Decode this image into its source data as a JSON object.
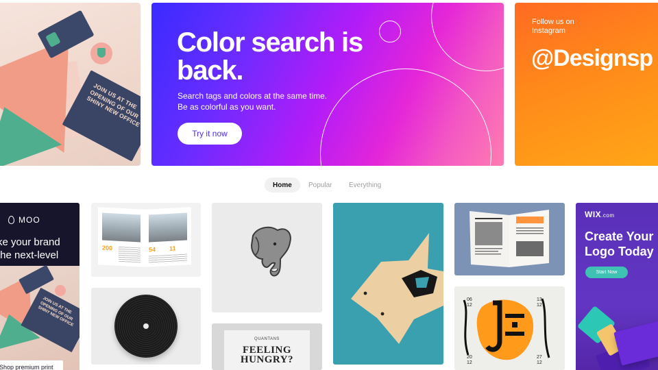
{
  "hero": {
    "left_card": {
      "card_text": "JOIN US AT THE OPENING OF OUR SHINY NEW OFFICE"
    },
    "main": {
      "title": "Color search is back.",
      "subtitle": "Search tags and colors at the same time. Be as colorful as you want.",
      "button_label": "Try it now"
    },
    "right": {
      "follow_text": "Follow us on Instagram",
      "handle": "@Designsp"
    }
  },
  "tabs": [
    {
      "label": "Home",
      "active": true
    },
    {
      "label": "Popular",
      "active": false
    },
    {
      "label": "Everything",
      "active": false
    }
  ],
  "tiles": {
    "moo": {
      "logo": "MOO",
      "copy_line1": "ke your brand",
      "copy_line2": "the next-level",
      "card_text": "JOIN US AT THE OPENING OF OUR SHINY NEW OFFICE",
      "cta": "Shop premium print"
    },
    "brochure": {
      "num_left": "200",
      "num_mid": "54",
      "num_right": "11"
    },
    "hungry": {
      "logo": "QUANTANS",
      "title_line1": "FEELING",
      "title_line2": "HUNGRY?"
    },
    "jazz": {
      "date_top_left": "06\n12",
      "date_top_right": "13\n12",
      "date_bottom_left": "20\n12",
      "date_bottom_right": "27\n12"
    },
    "wix": {
      "logo": "WIX",
      "logo_suffix": ".com",
      "title_line1": "Create Your",
      "title_line2": "Logo Today",
      "button_label": "Start Now"
    }
  },
  "colors": {
    "hero_gradient_start": "#3a2bff",
    "hero_gradient_end": "#ff7bb1",
    "instagram_orange": "#ff8a1a",
    "wix_purple": "#5a2fb8",
    "wix_teal": "#3fc1b4",
    "moo_navy": "#17152b",
    "fox_teal": "#3a9faf"
  }
}
